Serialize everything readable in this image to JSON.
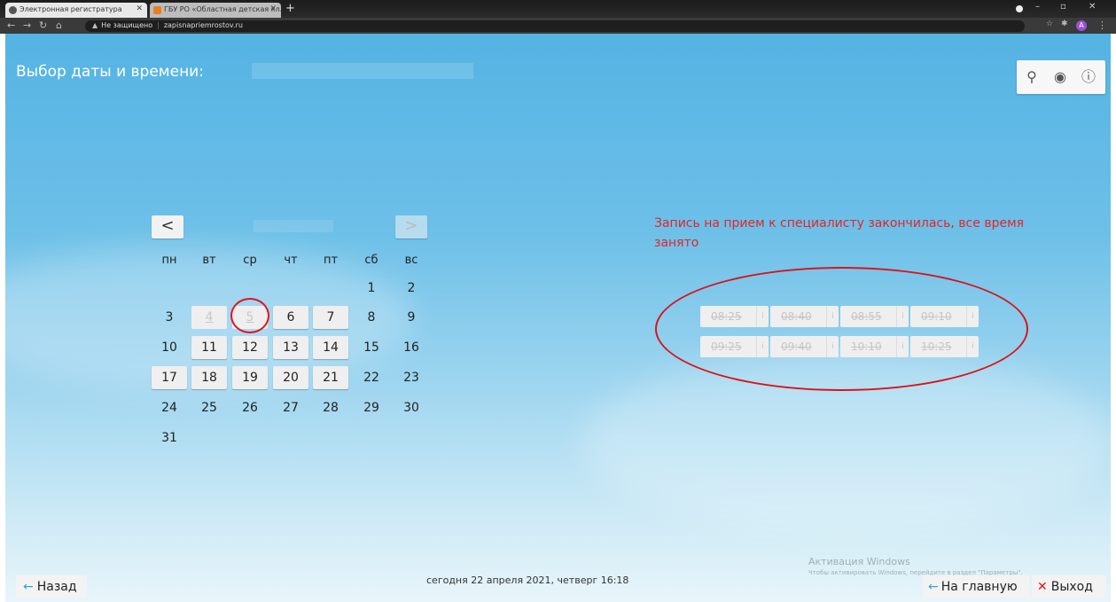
{
  "browser": {
    "tabs": [
      {
        "title": "Электронная регистратура"
      },
      {
        "title": "ГБУ РО «Областная детская кл..."
      }
    ],
    "new_tab": "+",
    "url_warning": "Не защищено",
    "url": "zapisnapriemrostov.ru",
    "profile_initial": "A"
  },
  "page": {
    "title": "Выбор даты и времени:",
    "tools": [
      "search-icon",
      "eye-icon",
      "info-icon"
    ]
  },
  "calendar": {
    "prev": "<",
    "next": ">",
    "weekdays": [
      "пн",
      "вт",
      "ср",
      "чт",
      "пт",
      "сб",
      "вс"
    ],
    "days": {
      "d1": "1",
      "d2": "2",
      "d3": "3",
      "d4": "4",
      "d5": "5",
      "d6": "6",
      "d7": "7",
      "d8": "8",
      "d9": "9",
      "d10": "10",
      "d11": "11",
      "d12": "12",
      "d13": "13",
      "d14": "14",
      "d15": "15",
      "d16": "16",
      "d17": "17",
      "d18": "18",
      "d19": "19",
      "d20": "20",
      "d21": "21",
      "d22": "22",
      "d23": "23",
      "d24": "24",
      "d25": "25",
      "d26": "26",
      "d27": "27",
      "d28": "28",
      "d29": "29",
      "d30": "30",
      "d31": "31"
    }
  },
  "message": "Запись на прием к специалисту закончилась, все время занято",
  "slots": [
    "08:25",
    "08:40",
    "08:55",
    "09:10",
    "09:25",
    "09:40",
    "10:10",
    "10:25"
  ],
  "slot_info": "i",
  "footer": {
    "back": "Назад",
    "today": "сегодня 22 апреля 2021, четверг 16:18",
    "home": "На главную",
    "exit": "Выход"
  },
  "windows_watermark": {
    "line1": "Активация Windows",
    "line2": "Чтобы активировать Windows, перейдите в раздел \"Параметры\"."
  },
  "colors": {
    "accent": "#3aa0d8",
    "alert": "#e5252a"
  }
}
